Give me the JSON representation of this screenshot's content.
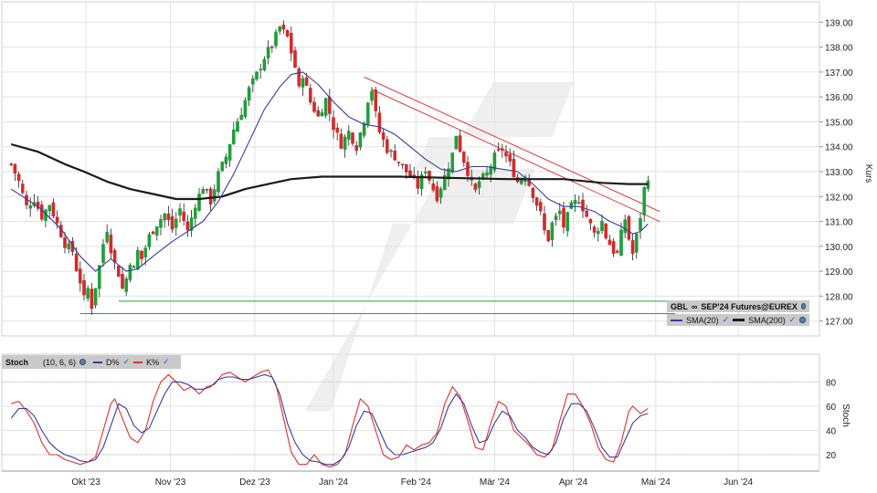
{
  "chart_data": [
    {
      "type": "candlestick",
      "title": "",
      "ylabel": "Kurs",
      "ylim": [
        126.4,
        139.6
      ],
      "yticks": [
        "139.00",
        "138.00",
        "137.00",
        "136.00",
        "135.00",
        "134.00",
        "133.00",
        "132.00",
        "131.00",
        "130.00",
        "129.00",
        "128.00",
        "127.00"
      ],
      "months": [
        {
          "label": "Okt '23",
          "pos": 0.5
        },
        {
          "label": "Nov '23",
          "pos": 22.5
        },
        {
          "label": "Dez '23",
          "pos": 44.5
        },
        {
          "label": "Jan '24",
          "pos": 65
        },
        {
          "label": "Feb '24",
          "pos": 86.5
        },
        {
          "label": "Mär '24",
          "pos": 107
        },
        {
          "label": "Apr '24",
          "pos": 127.5
        },
        {
          "label": "Mai '24",
          "pos": 149
        },
        {
          "label": "Jun '24",
          "pos": 170.5
        }
      ],
      "close_path": [
        [
          -19,
          133.3
        ],
        [
          -17,
          132.6
        ],
        [
          -15,
          131.6
        ],
        [
          -13,
          131.9
        ],
        [
          -11,
          131.2
        ],
        [
          -9,
          131.7
        ],
        [
          -7,
          130.9
        ],
        [
          -5,
          130.1
        ],
        [
          -3,
          129.8
        ],
        [
          -2,
          129.1
        ],
        [
          -1,
          128.6
        ],
        [
          0,
          127.9
        ],
        [
          1,
          128.3
        ],
        [
          2,
          127.6
        ],
        [
          3,
          128.4
        ],
        [
          4,
          129.2
        ],
        [
          5,
          130.1
        ],
        [
          6,
          130.7
        ],
        [
          7,
          129.9
        ],
        [
          8,
          129.3
        ],
        [
          9,
          128.9
        ],
        [
          10,
          128.3
        ],
        [
          11,
          128.7
        ],
        [
          12,
          129.4
        ],
        [
          13,
          129.1
        ],
        [
          14,
          129.8
        ],
        [
          15,
          129.5
        ],
        [
          17,
          130.4
        ],
        [
          19,
          130.9
        ],
        [
          21,
          131.3
        ],
        [
          23,
          130.7
        ],
        [
          25,
          131.5
        ],
        [
          27,
          130.6
        ],
        [
          29,
          131.7
        ],
        [
          31,
          132.4
        ],
        [
          33,
          131.8
        ],
        [
          35,
          132.9
        ],
        [
          37,
          133.6
        ],
        [
          39,
          134.7
        ],
        [
          41,
          135.4
        ],
        [
          43,
          136.3
        ],
        [
          45,
          136.9
        ],
        [
          47,
          137.6
        ],
        [
          49,
          138.1
        ],
        [
          51,
          138.8
        ],
        [
          53,
          138.4
        ],
        [
          55,
          137.2
        ],
        [
          56,
          136.3
        ],
        [
          57,
          136.9
        ],
        [
          59,
          135.8
        ],
        [
          61,
          135.2
        ],
        [
          63,
          135.9
        ],
        [
          65,
          134.8
        ],
        [
          67,
          134.1
        ],
        [
          69,
          134.6
        ],
        [
          71,
          134.0
        ],
        [
          73,
          135.1
        ],
        [
          74,
          135.9
        ],
        [
          75,
          136.3
        ],
        [
          76,
          135.3
        ],
        [
          77,
          134.6
        ],
        [
          79,
          133.9
        ],
        [
          81,
          133.6
        ],
        [
          83,
          133.2
        ],
        [
          85,
          132.8
        ],
        [
          87,
          132.4
        ],
        [
          89,
          133.1
        ],
        [
          91,
          132.3
        ],
        [
          92,
          132.0
        ],
        [
          94,
          132.8
        ],
        [
          96,
          133.7
        ],
        [
          97,
          134.5
        ],
        [
          98,
          133.9
        ],
        [
          100,
          133.0
        ],
        [
          101,
          132.5
        ],
        [
          102,
          132.2
        ],
        [
          103,
          132.6
        ],
        [
          105,
          132.9
        ],
        [
          107,
          133.6
        ],
        [
          109,
          133.9
        ],
        [
          111,
          133.3
        ],
        [
          113,
          132.6
        ],
        [
          115,
          132.9
        ],
        [
          117,
          132.1
        ],
        [
          119,
          131.3
        ],
        [
          120,
          130.6
        ],
        [
          121,
          130.3
        ],
        [
          122,
          130.9
        ],
        [
          124,
          131.4
        ],
        [
          125,
          130.8
        ],
        [
          127,
          131.6
        ],
        [
          129,
          131.9
        ],
        [
          131,
          131.2
        ],
        [
          133,
          130.5
        ],
        [
          135,
          131.0
        ],
        [
          136,
          130.4
        ],
        [
          138,
          129.8
        ],
        [
          139,
          129.7
        ],
        [
          140,
          130.5
        ],
        [
          141,
          131.1
        ],
        [
          142,
          130.3
        ],
        [
          143,
          129.7
        ],
        [
          144,
          130.4
        ],
        [
          145,
          131.2
        ],
        [
          146,
          132.3
        ],
        [
          147,
          132.8
        ]
      ],
      "sma20": [
        [
          -19,
          132.3
        ],
        [
          -12,
          131.6
        ],
        [
          -6,
          130.7
        ],
        [
          -1,
          129.6
        ],
        [
          3,
          129.0
        ],
        [
          7,
          129.5
        ],
        [
          11,
          129.0
        ],
        [
          14,
          129.1
        ],
        [
          18,
          129.6
        ],
        [
          23,
          130.2
        ],
        [
          27,
          130.6
        ],
        [
          31,
          131.0
        ],
        [
          35,
          131.8
        ],
        [
          39,
          132.9
        ],
        [
          43,
          134.2
        ],
        [
          47,
          135.5
        ],
        [
          51,
          136.4
        ],
        [
          54,
          136.9
        ],
        [
          57,
          137.0
        ],
        [
          61,
          136.5
        ],
        [
          65,
          135.8
        ],
        [
          69,
          135.2
        ],
        [
          73,
          134.9
        ],
        [
          77,
          134.8
        ],
        [
          81,
          134.5
        ],
        [
          85,
          134.0
        ],
        [
          89,
          133.5
        ],
        [
          93,
          133.1
        ],
        [
          97,
          133.0
        ],
        [
          101,
          133.2
        ],
        [
          105,
          133.2
        ],
        [
          109,
          133.1
        ],
        [
          113,
          133.0
        ],
        [
          117,
          132.5
        ],
        [
          121,
          131.9
        ],
        [
          125,
          131.6
        ],
        [
          129,
          131.6
        ],
        [
          133,
          131.4
        ],
        [
          137,
          131.0
        ],
        [
          140,
          130.8
        ],
        [
          143,
          130.5
        ],
        [
          145,
          130.6
        ],
        [
          147,
          130.9
        ]
      ],
      "sma200": [
        [
          -19,
          134.1
        ],
        [
          -12,
          133.8
        ],
        [
          -5,
          133.3
        ],
        [
          0,
          133.0
        ],
        [
          6,
          132.6
        ],
        [
          12,
          132.3
        ],
        [
          18,
          132.1
        ],
        [
          24,
          131.9
        ],
        [
          30,
          131.9
        ],
        [
          36,
          132.0
        ],
        [
          42,
          132.3
        ],
        [
          48,
          132.5
        ],
        [
          54,
          132.7
        ],
        [
          62,
          132.8
        ],
        [
          72,
          132.8
        ],
        [
          82,
          132.8
        ],
        [
          95,
          132.75
        ],
        [
          110,
          132.7
        ],
        [
          125,
          132.7
        ],
        [
          135,
          132.55
        ],
        [
          142,
          132.5
        ],
        [
          147,
          132.5
        ]
      ],
      "trend_lines": [
        {
          "from": [
            73,
            136.8
          ],
          "to": [
            150,
            131.4
          ],
          "color": "#e03c3c"
        },
        {
          "from": [
            75,
            136.3
          ],
          "to": [
            150,
            131.0
          ],
          "color": "#e03c3c"
        }
      ],
      "support_lines": [
        {
          "from": [
            -1,
            127.3
          ],
          "to": [
            154,
            127.3
          ],
          "color": "#2e9e3c"
        },
        {
          "from": [
            9,
            127.8
          ],
          "to": [
            154,
            127.8
          ],
          "color": "#2e9e3c"
        }
      ],
      "legend": {
        "symbol": "GBL",
        "symbol_suffix": "SEP'24 Futures@EUREX",
        "sma20_label": "SMA(20)",
        "sma200_label": "SMA(200)"
      }
    },
    {
      "type": "line",
      "title": "",
      "ylabel": "Stoch",
      "ylim": [
        8,
        90
      ],
      "yticks": [
        "80",
        "60",
        "40",
        "20"
      ],
      "indicator_label": "Stoch",
      "params": "(10, 6, 6)",
      "series_names": [
        "D%",
        "K%"
      ],
      "k_path": [
        [
          -19,
          62
        ],
        [
          -17,
          64
        ],
        [
          -15,
          56
        ],
        [
          -13,
          46
        ],
        [
          -11,
          30
        ],
        [
          -9,
          20
        ],
        [
          -7,
          20
        ],
        [
          -5,
          16
        ],
        [
          -3,
          14
        ],
        [
          -1,
          12
        ],
        [
          1,
          14
        ],
        [
          3,
          18
        ],
        [
          5,
          40
        ],
        [
          7,
          62
        ],
        [
          8,
          66
        ],
        [
          10,
          50
        ],
        [
          12,
          34
        ],
        [
          14,
          30
        ],
        [
          16,
          40
        ],
        [
          18,
          64
        ],
        [
          20,
          80
        ],
        [
          22,
          86
        ],
        [
          24,
          80
        ],
        [
          26,
          73
        ],
        [
          28,
          76
        ],
        [
          30,
          70
        ],
        [
          32,
          76
        ],
        [
          34,
          78
        ],
        [
          36,
          86
        ],
        [
          38,
          88
        ],
        [
          40,
          84
        ],
        [
          42,
          80
        ],
        [
          44,
          84
        ],
        [
          46,
          88
        ],
        [
          48,
          90
        ],
        [
          50,
          78
        ],
        [
          52,
          50
        ],
        [
          54,
          22
        ],
        [
          56,
          12
        ],
        [
          58,
          12
        ],
        [
          60,
          20
        ],
        [
          62,
          12
        ],
        [
          64,
          10
        ],
        [
          66,
          12
        ],
        [
          68,
          20
        ],
        [
          70,
          44
        ],
        [
          72,
          66
        ],
        [
          74,
          60
        ],
        [
          76,
          40
        ],
        [
          78,
          20
        ],
        [
          80,
          16
        ],
        [
          82,
          18
        ],
        [
          84,
          28
        ],
        [
          86,
          24
        ],
        [
          88,
          28
        ],
        [
          90,
          30
        ],
        [
          92,
          38
        ],
        [
          94,
          62
        ],
        [
          96,
          76
        ],
        [
          98,
          68
        ],
        [
          100,
          48
        ],
        [
          102,
          26
        ],
        [
          104,
          24
        ],
        [
          106,
          46
        ],
        [
          108,
          64
        ],
        [
          110,
          60
        ],
        [
          112,
          40
        ],
        [
          114,
          34
        ],
        [
          116,
          28
        ],
        [
          118,
          20
        ],
        [
          120,
          18
        ],
        [
          122,
          24
        ],
        [
          124,
          48
        ],
        [
          126,
          70
        ],
        [
          128,
          70
        ],
        [
          130,
          60
        ],
        [
          132,
          46
        ],
        [
          134,
          26
        ],
        [
          136,
          16
        ],
        [
          138,
          14
        ],
        [
          140,
          30
        ],
        [
          142,
          56
        ],
        [
          143,
          60
        ],
        [
          145,
          54
        ],
        [
          146,
          56
        ],
        [
          147,
          58
        ]
      ],
      "d_path": [
        [
          -19,
          50
        ],
        [
          -17,
          58
        ],
        [
          -15,
          58
        ],
        [
          -13,
          52
        ],
        [
          -11,
          40
        ],
        [
          -9,
          30
        ],
        [
          -7,
          24
        ],
        [
          -5,
          20
        ],
        [
          -3,
          18
        ],
        [
          -1,
          15
        ],
        [
          1,
          14
        ],
        [
          3,
          16
        ],
        [
          5,
          26
        ],
        [
          7,
          44
        ],
        [
          9,
          62
        ],
        [
          11,
          58
        ],
        [
          13,
          44
        ],
        [
          15,
          38
        ],
        [
          17,
          42
        ],
        [
          19,
          56
        ],
        [
          21,
          70
        ],
        [
          23,
          80
        ],
        [
          25,
          80
        ],
        [
          27,
          78
        ],
        [
          29,
          74
        ],
        [
          31,
          74
        ],
        [
          33,
          76
        ],
        [
          35,
          82
        ],
        [
          37,
          84
        ],
        [
          39,
          84
        ],
        [
          41,
          82
        ],
        [
          43,
          82
        ],
        [
          45,
          84
        ],
        [
          47,
          86
        ],
        [
          49,
          84
        ],
        [
          51,
          70
        ],
        [
          53,
          46
        ],
        [
          55,
          30
        ],
        [
          57,
          20
        ],
        [
          59,
          15
        ],
        [
          61,
          14
        ],
        [
          63,
          12
        ],
        [
          65,
          12
        ],
        [
          67,
          16
        ],
        [
          69,
          26
        ],
        [
          71,
          44
        ],
        [
          73,
          56
        ],
        [
          75,
          54
        ],
        [
          77,
          40
        ],
        [
          79,
          26
        ],
        [
          81,
          20
        ],
        [
          83,
          20
        ],
        [
          85,
          22
        ],
        [
          87,
          24
        ],
        [
          89,
          26
        ],
        [
          91,
          30
        ],
        [
          93,
          42
        ],
        [
          95,
          60
        ],
        [
          97,
          70
        ],
        [
          99,
          62
        ],
        [
          101,
          44
        ],
        [
          103,
          30
        ],
        [
          105,
          32
        ],
        [
          107,
          46
        ],
        [
          109,
          56
        ],
        [
          111,
          52
        ],
        [
          113,
          40
        ],
        [
          115,
          34
        ],
        [
          117,
          26
        ],
        [
          119,
          22
        ],
        [
          121,
          20
        ],
        [
          123,
          30
        ],
        [
          125,
          50
        ],
        [
          127,
          62
        ],
        [
          129,
          62
        ],
        [
          131,
          56
        ],
        [
          133,
          42
        ],
        [
          135,
          26
        ],
        [
          137,
          18
        ],
        [
          139,
          18
        ],
        [
          141,
          32
        ],
        [
          143,
          46
        ],
        [
          145,
          52
        ],
        [
          147,
          54
        ]
      ],
      "reference_lines": [
        80,
        20
      ]
    }
  ],
  "icons": {
    "settings": "gear-dot-icon",
    "visible": "checkmark-icon",
    "symbol_link": "infinity-icon"
  },
  "colors": {
    "up": "#1e9e3a",
    "down": "#d42a2a",
    "sma20": "#3a3aa0",
    "sma200": "#1a1a1a",
    "k": "#e03030",
    "d": "#3a3a9e"
  }
}
